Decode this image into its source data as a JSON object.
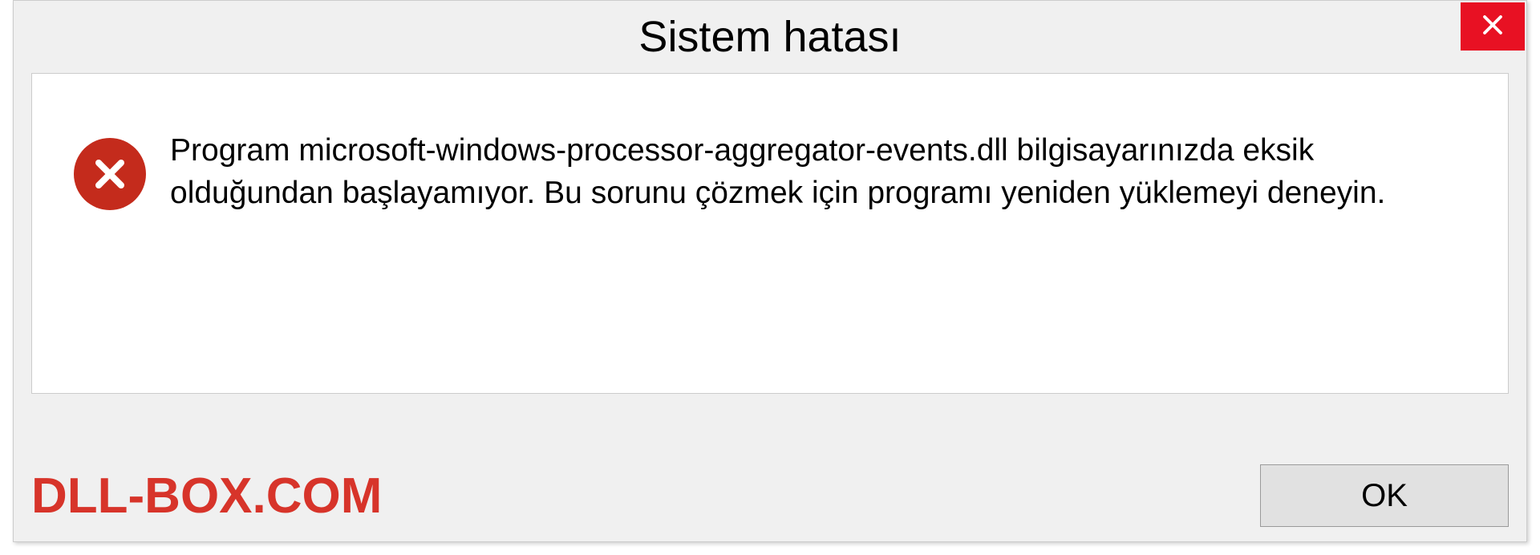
{
  "dialog": {
    "title": "Sistem hatası",
    "message": "Program microsoft-windows-processor-aggregator-events.dll bilgisayarınızda eksik olduğundan başlayamıyor. Bu sorunu çözmek için programı yeniden yüklemeyi deneyin.",
    "ok_label": "OK"
  },
  "watermark": "DLL-BOX.COM"
}
